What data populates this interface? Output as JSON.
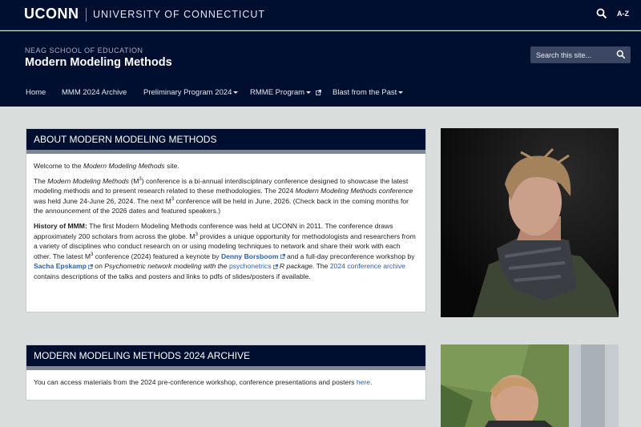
{
  "topbar": {
    "logo": "UCONN",
    "university": "UNIVERSITY OF CONNECTICUT",
    "az_label": "A-Z",
    "search_icon": "search-icon"
  },
  "header": {
    "school": "NEAG SCHOOL OF EDUCATION",
    "title": "Modern Modeling Methods",
    "search_placeholder": "Search this site..."
  },
  "nav": {
    "items": [
      {
        "label": "Home"
      },
      {
        "label": "MMM 2024 Archive"
      },
      {
        "label": "Preliminary Program 2024"
      },
      {
        "label": "RMME Program"
      },
      {
        "label": "Blast from the Past"
      }
    ]
  },
  "about": {
    "heading": "ABOUT MODERN MODELING METHODS",
    "p1_a": "Welcome to the ",
    "p1_em": "Modern Modeling Methods",
    "p1_b": " site.",
    "p2_a": "The ",
    "p2_em1": "Modern Modeling Methods",
    "p2_b": " (M",
    "p2_sup1": "3",
    "p2_c": ") conference is a bi-annual interdisciplinary conference designed to showcase the latest modeling methods and to present research related to these methodologies. The 2024 ",
    "p2_em2": "Modern Modeling Methods conference",
    "p2_d": " was held June 24-June 26, 2024. The next M",
    "p2_sup2": "3",
    "p2_e": " conference will be held in June, 2026. (Check back in the coming months for the announcement of the 2026 dates and featured speakers.)",
    "p3_strong": "History of MMM:",
    "p3_a": " The first Modern Modeling Methods conference was held at UCONN in 2011. The conference draws approximately 200 scholars from across the globe. M",
    "p3_sup1": "3",
    "p3_b": " provides a unique opportunity for methodologists and researchers from a variety of disciplines who conduct research on or using modeling techniques to network and share their work with each other. The latest M",
    "p3_sup2": "3",
    "p3_c": " conference (2024) featured a keynote by ",
    "link_denny": "Denny Borsboom",
    "p3_d": " and a full-day preconference workshop by ",
    "link_sacha": "Sacha Epskamp",
    "p3_e": " on ",
    "p3_em1": "Psychometric network modeling with the ",
    "link_psych": "psychonetrics",
    "p3_em2": " R package",
    "p3_f": ". The ",
    "link_archive": "2024 conference archive",
    "p3_g": " contains descriptions of the talks and posters and links to pdfs of slides/posters if available."
  },
  "archive": {
    "heading": "MODERN MODELING METHODS 2024 ARCHIVE",
    "text": "You can access materials from the 2024 pre-conference workshop, conference presentations and posters ",
    "link": "here",
    "end": "."
  },
  "colors": {
    "navy": "#000e2f",
    "link": "#2b61a8",
    "background": "#d9dedd"
  }
}
